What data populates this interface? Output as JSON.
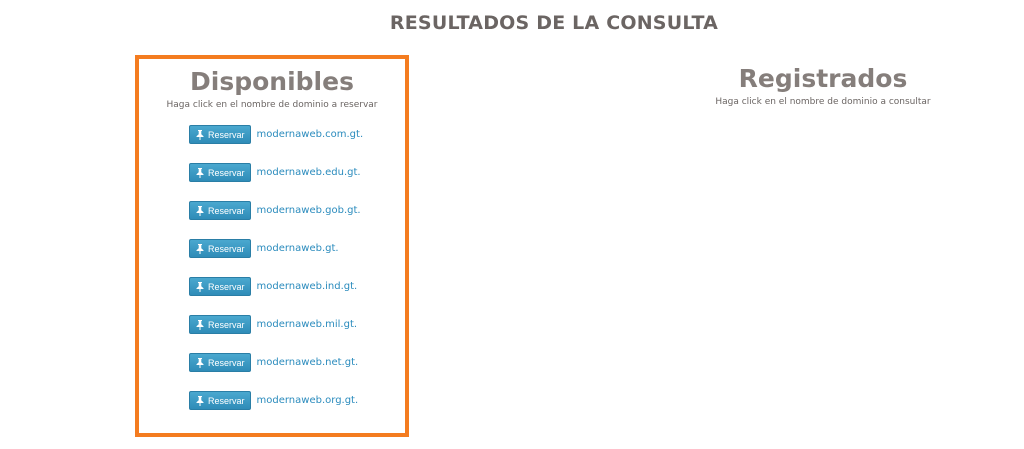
{
  "page": {
    "title": "RESULTADOS DE LA CONSULTA"
  },
  "available": {
    "heading": "Disponibles",
    "subtitle": "Haga click en el nombre de dominio a reservar",
    "button_label": "Reservar",
    "domains": [
      "modernaweb.com.gt.",
      "modernaweb.edu.gt.",
      "modernaweb.gob.gt.",
      "modernaweb.gt.",
      "modernaweb.ind.gt.",
      "modernaweb.mil.gt.",
      "modernaweb.net.gt.",
      "modernaweb.org.gt."
    ]
  },
  "registered": {
    "heading": "Registrados",
    "subtitle": "Haga click en el nombre de dominio a consultar"
  },
  "colors": {
    "highlight_border": "#f47c20",
    "button": "#3a9bc7",
    "link": "#2a8bbd",
    "heading": "#857e7b"
  },
  "icons": {
    "reserve_button_icon": "pin-icon"
  }
}
